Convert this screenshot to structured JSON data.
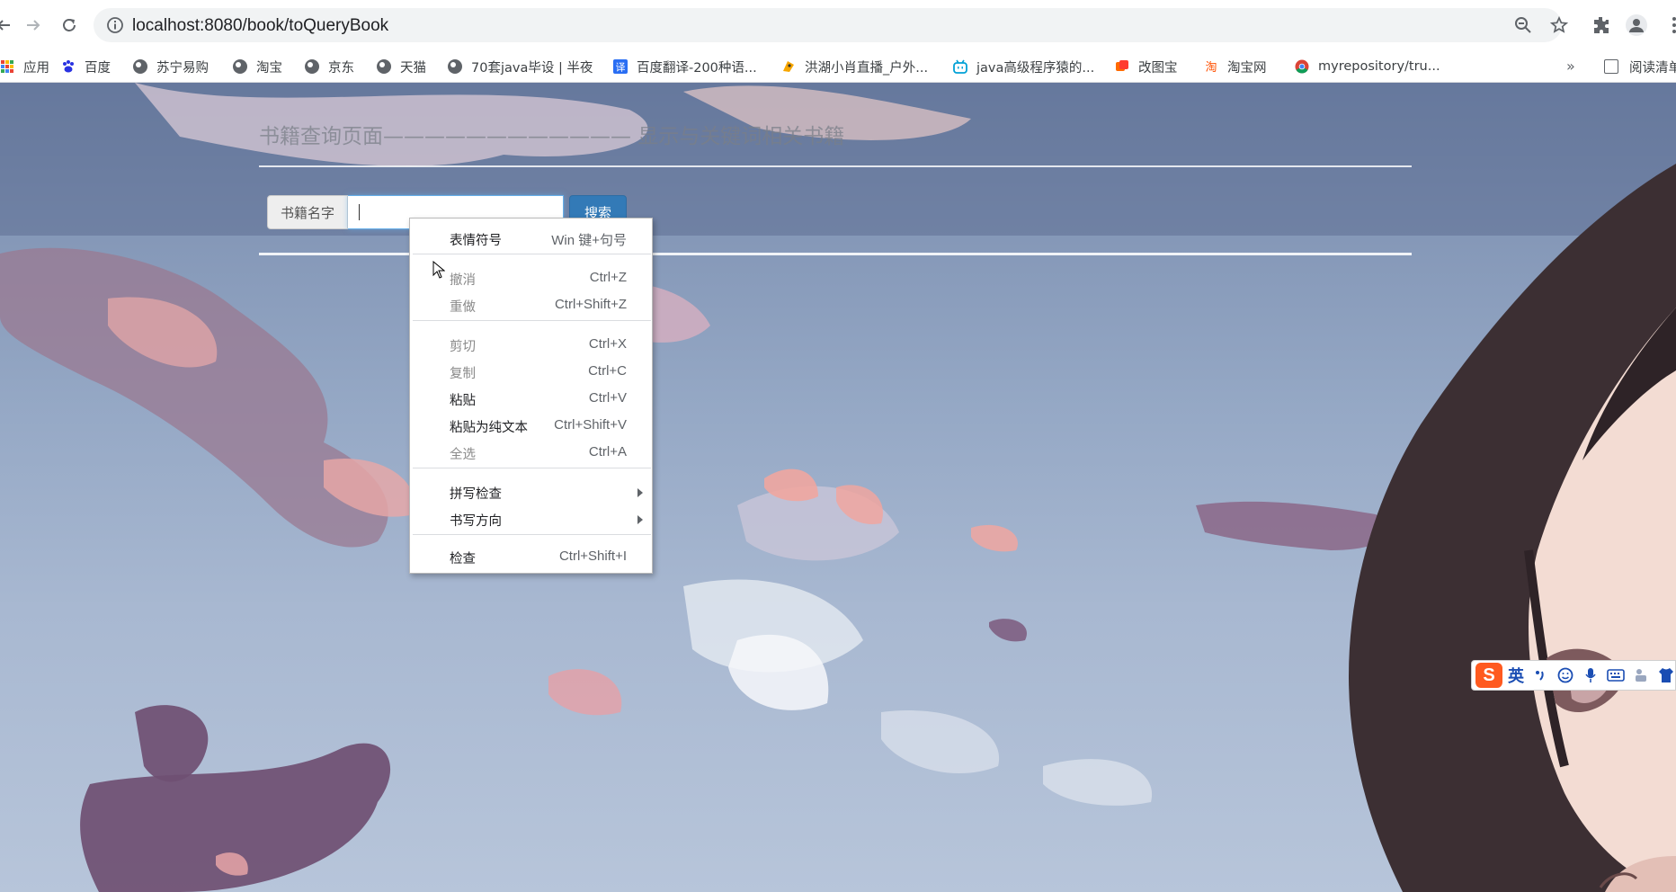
{
  "browser": {
    "url": "localhost:8080/book/toQueryBook"
  },
  "bookmarks": {
    "items": [
      {
        "label": "应用",
        "icon": "apps-grid-icon"
      },
      {
        "label": "百度",
        "icon": "baidu-paw-icon"
      },
      {
        "label": "苏宁易购",
        "icon": "globe-icon"
      },
      {
        "label": "淘宝",
        "icon": "globe-icon"
      },
      {
        "label": "京东",
        "icon": "globe-icon"
      },
      {
        "label": "天猫",
        "icon": "globe-icon"
      },
      {
        "label": "70套java毕设 | 半夜",
        "icon": "globe-icon"
      },
      {
        "label": "百度翻译-200种语...",
        "icon": "baidu-translate-icon"
      },
      {
        "label": "洪湖小肖直播_户外...",
        "icon": "douyu-icon"
      },
      {
        "label": "java高级程序猿的...",
        "icon": "bilibili-icon"
      },
      {
        "label": "改图宝",
        "icon": "gaitubao-icon"
      },
      {
        "label": "淘宝网",
        "icon": "taobao-icon"
      },
      {
        "label": "myrepository/tru...",
        "icon": "chrome-icon"
      }
    ],
    "reading_list_label": "阅读清单"
  },
  "page": {
    "heading": "书籍查询页面———————————— 显示与关键词相关书籍",
    "search_addon_label": "书籍名字",
    "search_input_value": "",
    "search_button_label": "搜索"
  },
  "context_menu": {
    "items": [
      {
        "label": "表情符号",
        "shortcut": "Win 键+句号",
        "enabled": true
      },
      {
        "label": "撤消",
        "shortcut": "Ctrl+Z",
        "enabled": false
      },
      {
        "label": "重做",
        "shortcut": "Ctrl+Shift+Z",
        "enabled": false
      },
      {
        "label": "剪切",
        "shortcut": "Ctrl+X",
        "enabled": false
      },
      {
        "label": "复制",
        "shortcut": "Ctrl+C",
        "enabled": false
      },
      {
        "label": "粘贴",
        "shortcut": "Ctrl+V",
        "enabled": true
      },
      {
        "label": "粘贴为纯文本",
        "shortcut": "Ctrl+Shift+V",
        "enabled": true
      },
      {
        "label": "全选",
        "shortcut": "Ctrl+A",
        "enabled": false
      },
      {
        "label": "拼写检查",
        "shortcut": "",
        "enabled": true,
        "submenu": true
      },
      {
        "label": "书写方向",
        "shortcut": "",
        "enabled": true,
        "submenu": true
      },
      {
        "label": "检查",
        "shortcut": "Ctrl+Shift+I",
        "enabled": true
      }
    ]
  },
  "ime_toolbar": {
    "logo": "S",
    "language": "英",
    "icons": [
      "punctuation-icon",
      "emoji-icon",
      "microphone-icon",
      "keyboard-icon",
      "toolbox-icon",
      "skin-icon"
    ]
  },
  "colors": {
    "search_button": "#337ab7",
    "ime_logo": "#ff5a1f",
    "sky": "#8497b7"
  }
}
